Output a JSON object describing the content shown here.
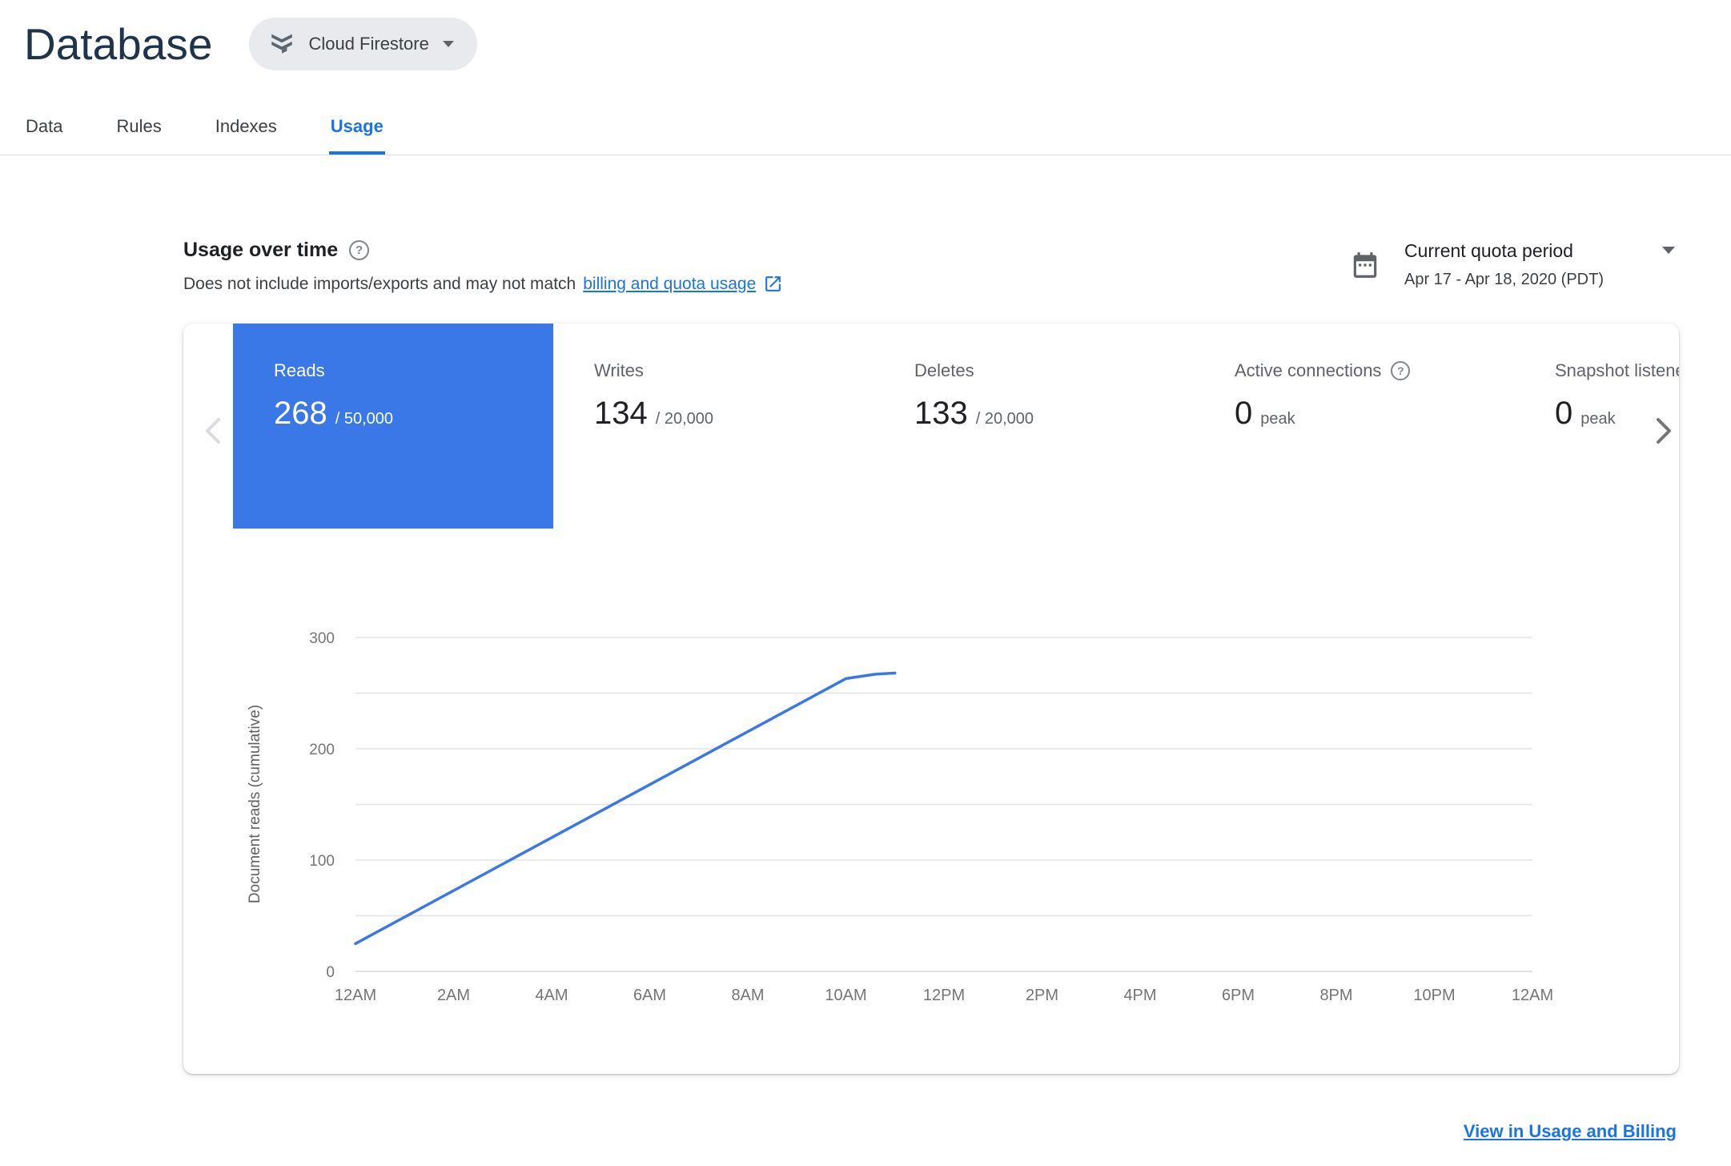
{
  "page": {
    "title": "Database"
  },
  "product_selector": {
    "label": "Cloud Firestore"
  },
  "tabs": [
    {
      "label": "Data",
      "active": false
    },
    {
      "label": "Rules",
      "active": false
    },
    {
      "label": "Indexes",
      "active": false
    },
    {
      "label": "Usage",
      "active": true
    }
  ],
  "usage_header": {
    "title": "Usage over time",
    "subtitle_prefix": "Does not include imports/exports and may not match",
    "subtitle_link": "billing and quota usage"
  },
  "quota_period": {
    "label": "Current quota period",
    "range": "Apr 17 - Apr 18, 2020 (PDT)"
  },
  "metrics": [
    {
      "label": "Reads",
      "value": "268",
      "suffix": "/ 50,000",
      "selected": true,
      "has_help": false
    },
    {
      "label": "Writes",
      "value": "134",
      "suffix": "/ 20,000",
      "selected": false,
      "has_help": false
    },
    {
      "label": "Deletes",
      "value": "133",
      "suffix": "/ 20,000",
      "selected": false,
      "has_help": false
    },
    {
      "label": "Active connections",
      "value": "0",
      "suffix": "peak",
      "selected": false,
      "has_help": true
    },
    {
      "label": "Snapshot listeners",
      "value": "0",
      "suffix": "peak",
      "selected": false,
      "has_help": false
    }
  ],
  "chart_data": {
    "type": "line",
    "title": "Usage over time",
    "ylabel": "Document reads (cumulative)",
    "xlabel": "",
    "x_ticks": [
      "12AM",
      "2AM",
      "4AM",
      "6AM",
      "8AM",
      "10AM",
      "12PM",
      "2PM",
      "4PM",
      "6PM",
      "8PM",
      "10PM",
      "12AM"
    ],
    "y_ticks": [
      0,
      100,
      200,
      300
    ],
    "ylim": [
      0,
      300
    ],
    "xlim_hours": [
      0,
      24
    ],
    "grid_interval": 50,
    "legend": "none",
    "series": [
      {
        "name": "Document reads (cumulative)",
        "color": "#3b78e7",
        "points": [
          {
            "x": 0,
            "y": 25
          },
          {
            "x": 10,
            "y": 263
          },
          {
            "x": 10.6,
            "y": 267
          },
          {
            "x": 11,
            "y": 268
          }
        ]
      }
    ]
  },
  "footer": {
    "link_label": "View in Usage and Billing"
  },
  "icons": {
    "help_glyph": "?"
  },
  "colors": {
    "accent_blue": "#1a73e8",
    "selected_tile_blue": "#3b78e7",
    "chart_line_blue": "#3b78e7",
    "pill_gray": "#e8eaed"
  }
}
